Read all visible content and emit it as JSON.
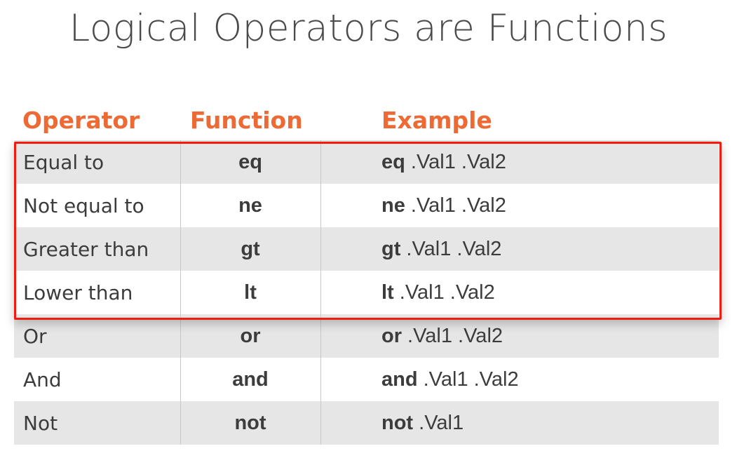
{
  "title": "Logical Operators are Functions",
  "table": {
    "headers": {
      "operator": "Operator",
      "function": "Function",
      "example": "Example"
    },
    "rows": [
      {
        "operator": "Equal to",
        "function": "eq",
        "example_fn": "eq",
        "example_args": " .Val1 .Val2"
      },
      {
        "operator": "Not equal to",
        "function": "ne",
        "example_fn": "ne",
        "example_args": " .Val1 .Val2"
      },
      {
        "operator": "Greater than",
        "function": "gt",
        "example_fn": "gt",
        "example_args": " .Val1 .Val2"
      },
      {
        "operator": "Lower than",
        "function": "lt",
        "example_fn": "lt",
        "example_args": " .Val1 .Val2"
      },
      {
        "operator": "Or",
        "function": "or",
        "example_fn": "or",
        "example_args": " .Val1 .Val2"
      },
      {
        "operator": "And",
        "function": "and",
        "example_fn": "and",
        "example_args": " .Val1 .Val2"
      },
      {
        "operator": "Not",
        "function": "not",
        "example_fn": "not",
        "example_args": " .Val1"
      }
    ]
  },
  "highlight": {
    "rows_highlighted": [
      "Equal to",
      "Not equal to",
      "Greater than",
      "Lower than"
    ],
    "color": "#f01c10"
  },
  "colors": {
    "header": "#ee6a35",
    "row_shade": "#e6e6e6",
    "text": "#3c3c3c"
  }
}
